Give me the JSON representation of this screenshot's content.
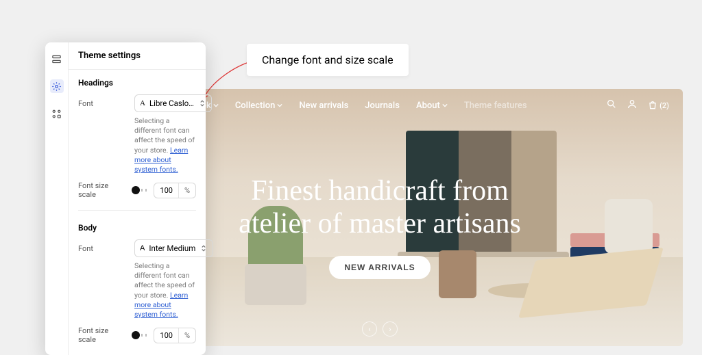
{
  "panel": {
    "title": "Theme settings",
    "headings": {
      "label": "Headings",
      "font_label": "Font",
      "font_value": "Libre Caslo…",
      "hint": "Selecting a different font can affect the speed of your store.",
      "hint_link": "Learn more about system fonts.",
      "scale_label": "Font size scale",
      "scale_value": "100",
      "scale_unit": "%"
    },
    "body": {
      "label": "Body",
      "font_label": "Font",
      "font_value": "Inter Medium",
      "hint": "Selecting a different font can affect the speed of your store.",
      "hint_link": "Learn more about system fonts.",
      "scale_label": "Font size scale",
      "scale_value": "100",
      "scale_unit": "%"
    }
  },
  "callout": "Change font and size scale",
  "preview": {
    "nav": {
      "l1": "ebook",
      "l2": "Collection",
      "l3": "New arrivals",
      "l4": "Journals",
      "l5": "About",
      "l6": "Theme features"
    },
    "cart_count": "(2)",
    "hero_line1": "Finest handicraft from",
    "hero_line2": "atelier of master artisans",
    "hero_cta": "NEW ARRIVALS"
  }
}
